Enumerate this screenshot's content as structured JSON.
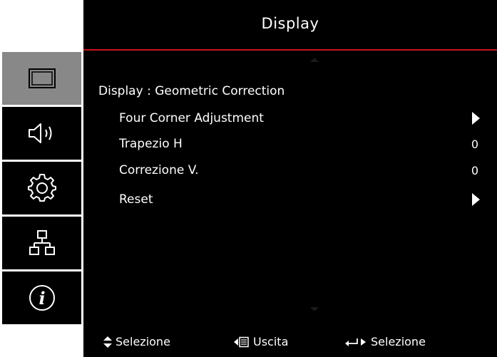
{
  "header": {
    "title": "Display"
  },
  "sidebar": {
    "tabs": [
      {
        "icon": "display-icon",
        "active": true
      },
      {
        "icon": "speaker-icon",
        "active": false
      },
      {
        "icon": "gear-icon",
        "active": false
      },
      {
        "icon": "network-icon",
        "active": false
      },
      {
        "icon": "info-icon",
        "active": false
      }
    ]
  },
  "main": {
    "breadcrumb": "Display : Geometric Correction",
    "items": [
      {
        "label": "Four Corner Adjustment",
        "value": "",
        "type": "submenu"
      },
      {
        "label": "Trapezio H",
        "value": "0",
        "type": "value"
      },
      {
        "label": "Correzione V.",
        "value": "0",
        "type": "value"
      },
      {
        "label": "Reset",
        "value": "",
        "type": "submenu"
      }
    ]
  },
  "footer": {
    "select_label": "Selezione",
    "exit_label": "Uscita",
    "enter_label": "Selezione"
  },
  "colors": {
    "accent": "#c8141e",
    "active_tab": "#888888"
  }
}
